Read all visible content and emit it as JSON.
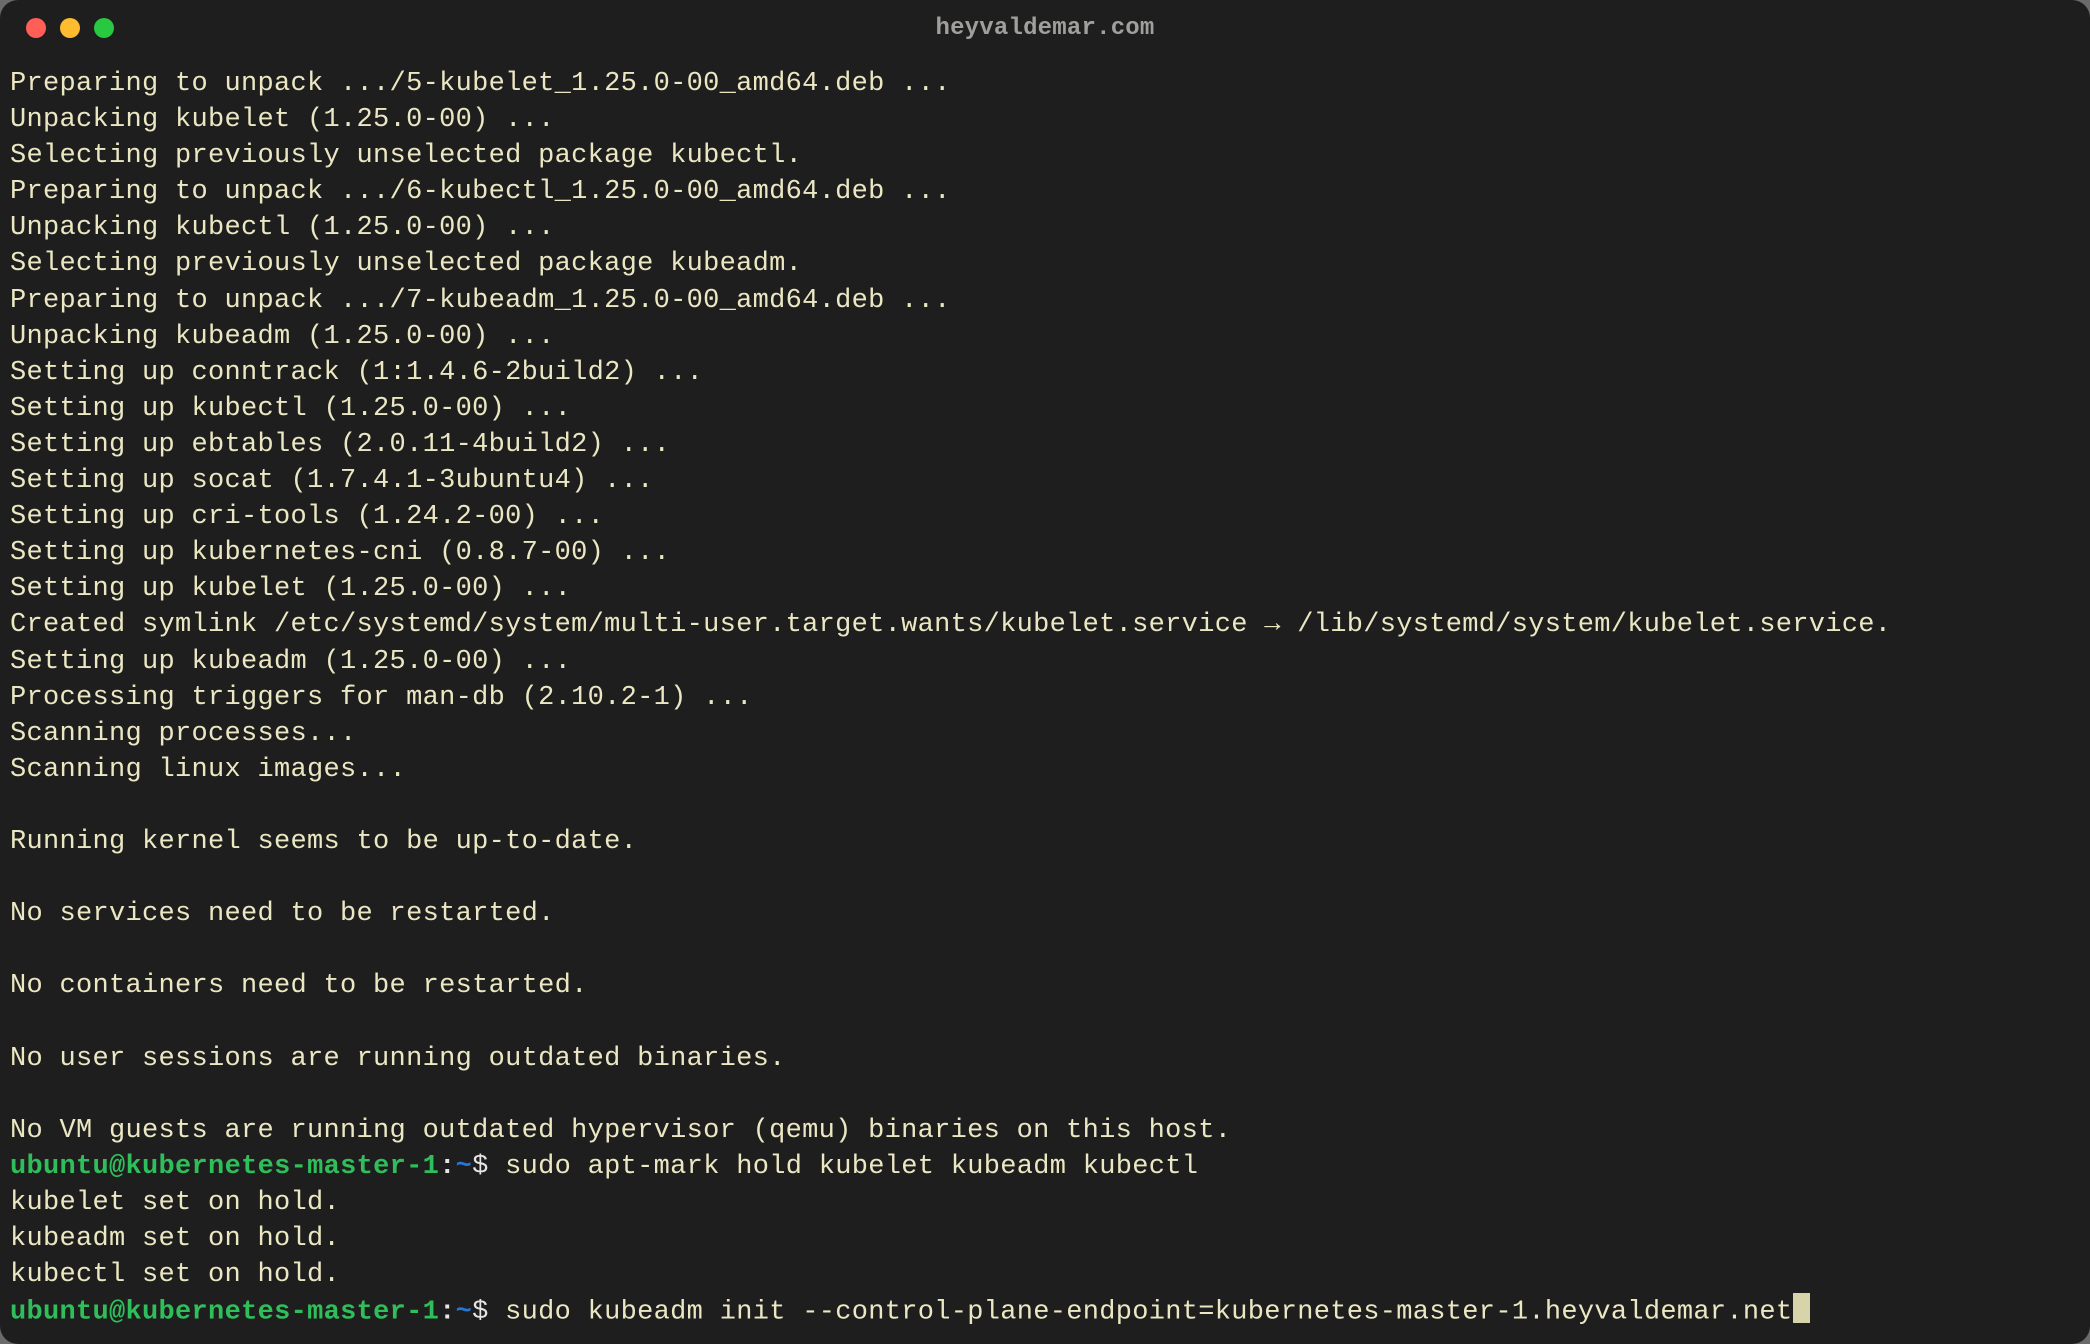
{
  "window": {
    "title": "heyvaldemar.com"
  },
  "traffic_lights": {
    "close": "close-icon",
    "minimize": "minimize-icon",
    "zoom": "zoom-icon"
  },
  "prompt": {
    "user": "ubuntu",
    "at": "@",
    "host": "kubernetes-master-1",
    "colon": ":",
    "path": "~",
    "sigil": "$"
  },
  "commands": {
    "hold": "sudo apt-mark hold kubelet kubeadm kubectl",
    "init": "sudo kubeadm init --control-plane-endpoint=kubernetes-master-1.heyvaldemar.net"
  },
  "output": {
    "lines": [
      "Preparing to unpack .../5-kubelet_1.25.0-00_amd64.deb ...",
      "Unpacking kubelet (1.25.0-00) ...",
      "Selecting previously unselected package kubectl.",
      "Preparing to unpack .../6-kubectl_1.25.0-00_amd64.deb ...",
      "Unpacking kubectl (1.25.0-00) ...",
      "Selecting previously unselected package kubeadm.",
      "Preparing to unpack .../7-kubeadm_1.25.0-00_amd64.deb ...",
      "Unpacking kubeadm (1.25.0-00) ...",
      "Setting up conntrack (1:1.4.6-2build2) ...",
      "Setting up kubectl (1.25.0-00) ...",
      "Setting up ebtables (2.0.11-4build2) ...",
      "Setting up socat (1.7.4.1-3ubuntu4) ...",
      "Setting up cri-tools (1.24.2-00) ...",
      "Setting up kubernetes-cni (0.8.7-00) ...",
      "Setting up kubelet (1.25.0-00) ...",
      "Created symlink /etc/systemd/system/multi-user.target.wants/kubelet.service → /lib/systemd/system/kubelet.service.",
      "Setting up kubeadm (1.25.0-00) ...",
      "Processing triggers for man-db (2.10.2-1) ...",
      "Scanning processes...",
      "Scanning linux images...",
      "",
      "Running kernel seems to be up-to-date.",
      "",
      "No services need to be restarted.",
      "",
      "No containers need to be restarted.",
      "",
      "No user sessions are running outdated binaries.",
      "",
      "No VM guests are running outdated hypervisor (qemu) binaries on this host."
    ],
    "hold_result": [
      "kubelet set on hold.",
      "kubeadm set on hold.",
      "kubectl set on hold."
    ]
  }
}
